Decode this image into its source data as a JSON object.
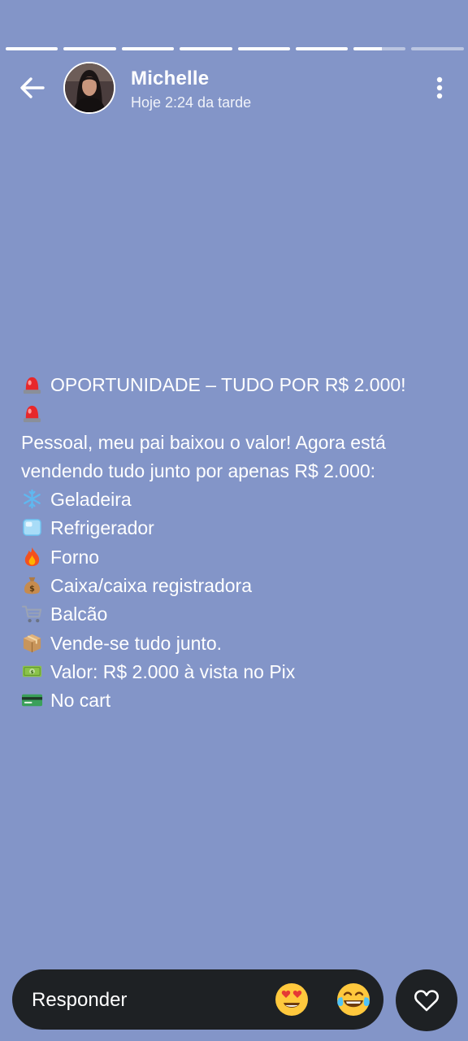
{
  "story": {
    "segments": [
      {
        "fill": 1
      },
      {
        "fill": 1
      },
      {
        "fill": 1
      },
      {
        "fill": 1
      },
      {
        "fill": 1
      },
      {
        "fill": 1
      },
      {
        "fill": 0.55
      },
      {
        "fill": 0
      }
    ]
  },
  "header": {
    "back_icon": "arrow-left-icon",
    "name": "Michelle",
    "time": "Hoje 2:24 da tarde",
    "menu_icon": "more-vertical-icon"
  },
  "status_text": {
    "title_prefix_icon": "rotating-light-icon",
    "title": "OPORTUNIDADE – TUDO POR R$ 2.000!",
    "title_suffix_icon": "rotating-light-icon",
    "body": "Pessoal, meu pai baixou o valor! Agora está vendendo tudo junto por apenas R$ 2.000:",
    "items": [
      {
        "icon": "snowflake-icon",
        "text": "Geladeira"
      },
      {
        "icon": "ice-cube-icon",
        "text": "Refrigerador"
      },
      {
        "icon": "fire-icon",
        "text": "Forno"
      },
      {
        "icon": "money-bag-icon",
        "text": "Caixa/caixa registradora"
      },
      {
        "icon": "shopping-cart-icon",
        "text": "Balcão"
      },
      {
        "icon": "package-icon",
        "text": "Vende-se tudo junto."
      },
      {
        "icon": "dollar-banknote-icon",
        "text": "Valor: R$ 2.000 à vista no Pix"
      },
      {
        "icon": "credit-card-icon",
        "text": "No cart"
      }
    ]
  },
  "reply": {
    "placeholder": "Responder",
    "reactions": [
      "heart-eyes-emoji-icon",
      "tears-of-joy-emoji-icon"
    ],
    "like_icon": "heart-icon"
  },
  "colors": {
    "background": "#8395c8",
    "reply_bar": "#1e2124",
    "text": "#ffffff"
  }
}
